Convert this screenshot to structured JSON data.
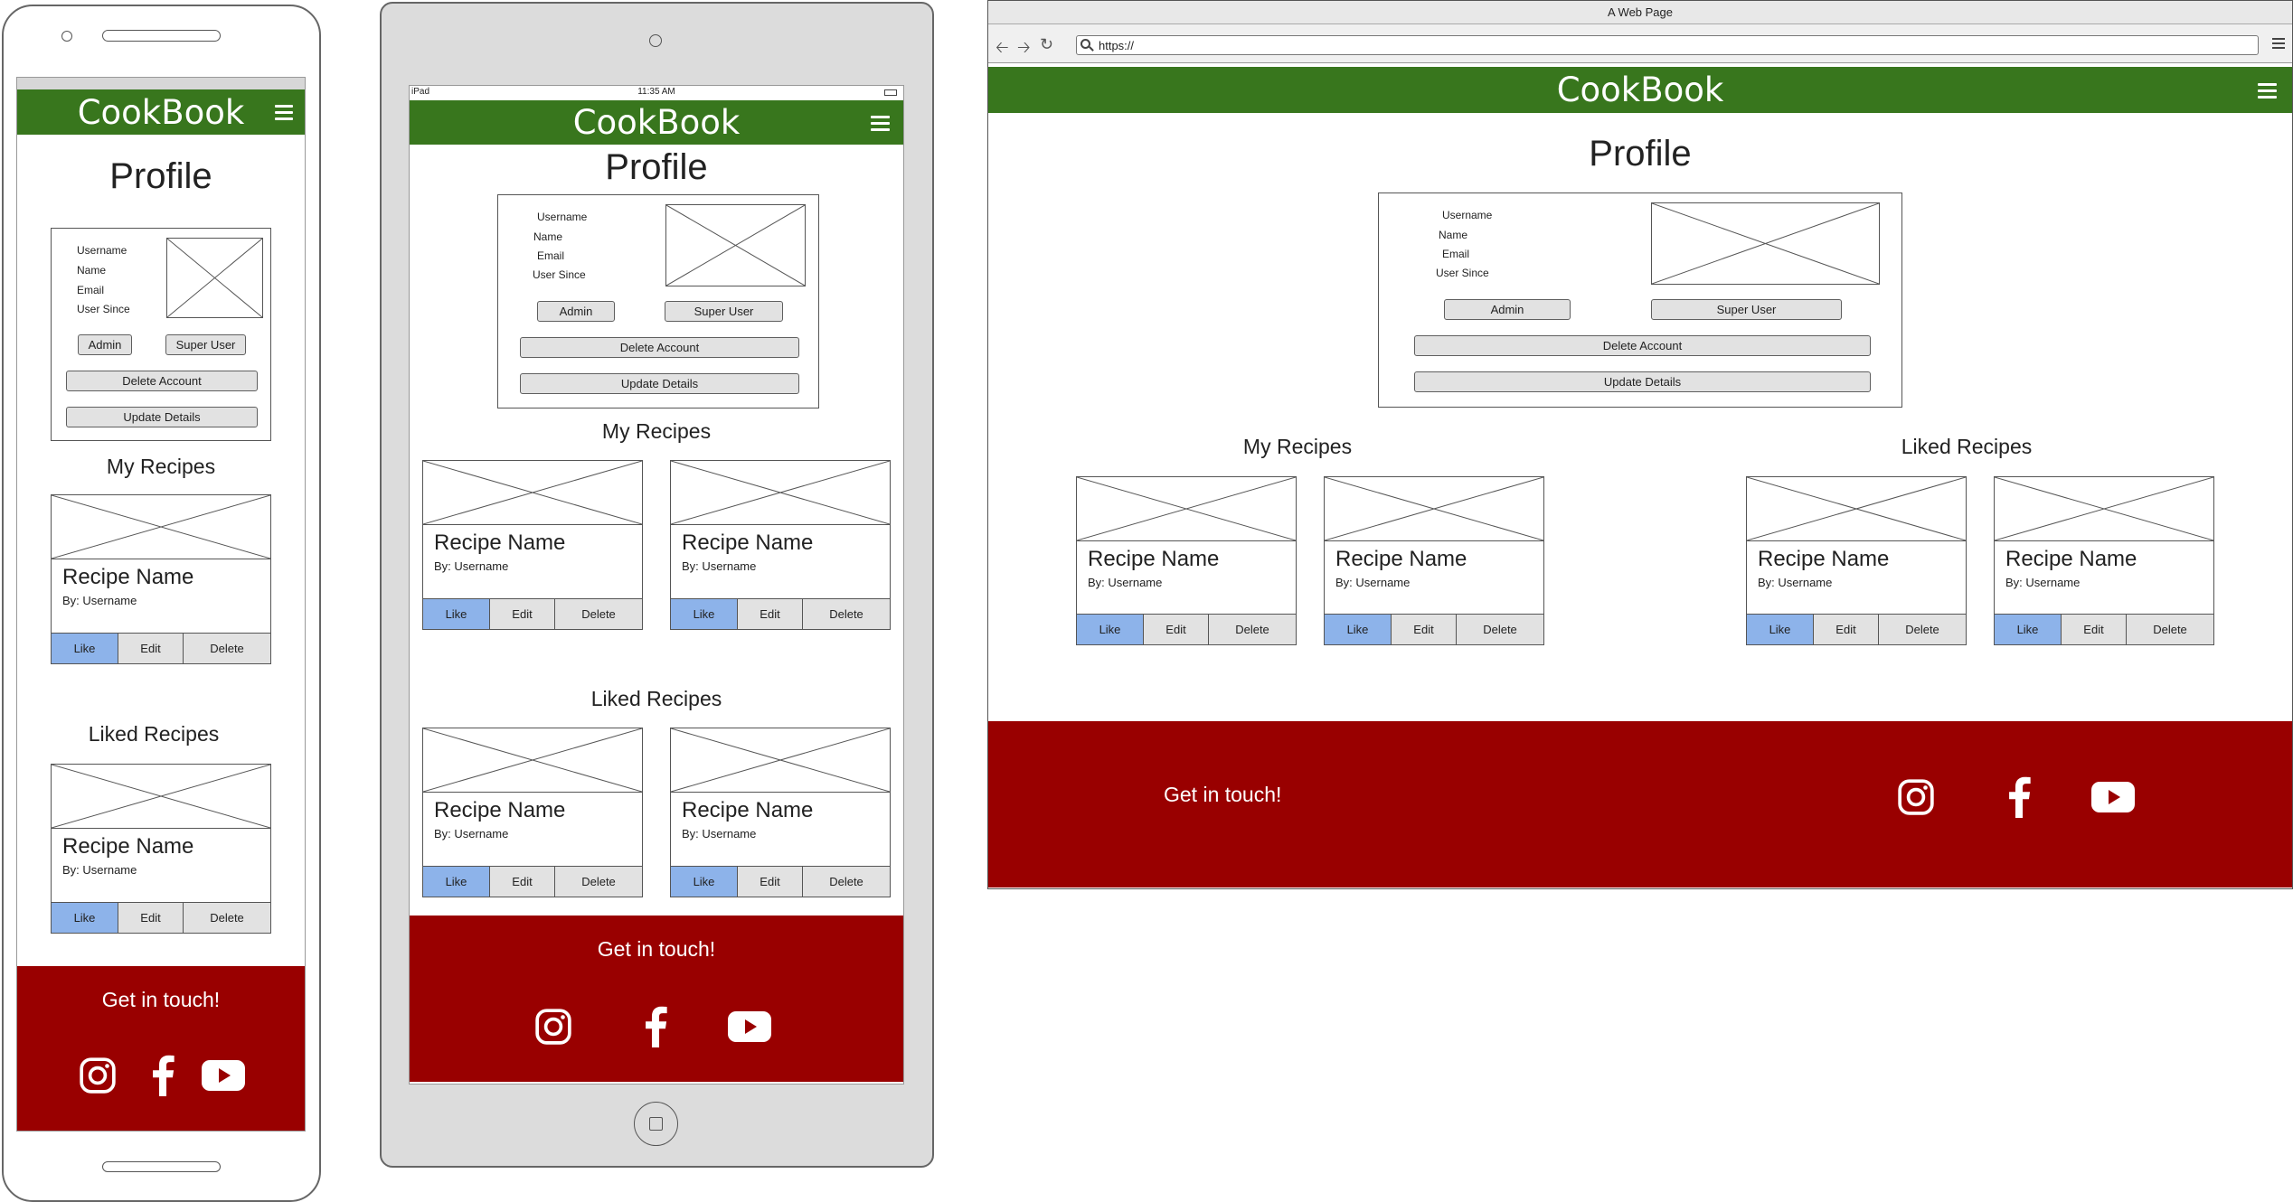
{
  "app": {
    "brand": "CookBook"
  },
  "browser": {
    "window_title": "A Web Page",
    "address": "https://"
  },
  "tablet_status": {
    "left": "iPad",
    "time": "11:35 AM"
  },
  "profile": {
    "title": "Profile",
    "fields": [
      "Username",
      "Name",
      "Email",
      "User Since"
    ],
    "admin_label": "Admin",
    "super_user_label": "Super User",
    "delete_label": "Delete Account",
    "update_label": "Update Details"
  },
  "sections": {
    "my_recipes": "My Recipes",
    "liked_recipes": "Liked Recipes"
  },
  "recipe_card": {
    "name": "Recipe Name",
    "author": "By: Username",
    "like_label": "Like",
    "edit_label": "Edit",
    "delete_label": "Delete"
  },
  "footer": {
    "heading": "Get in touch!",
    "icons": [
      "instagram-icon",
      "facebook-icon",
      "youtube-icon"
    ]
  },
  "colors": {
    "header_green": "#38761d",
    "footer_red": "#990000",
    "like_blue": "#8db3ea"
  }
}
